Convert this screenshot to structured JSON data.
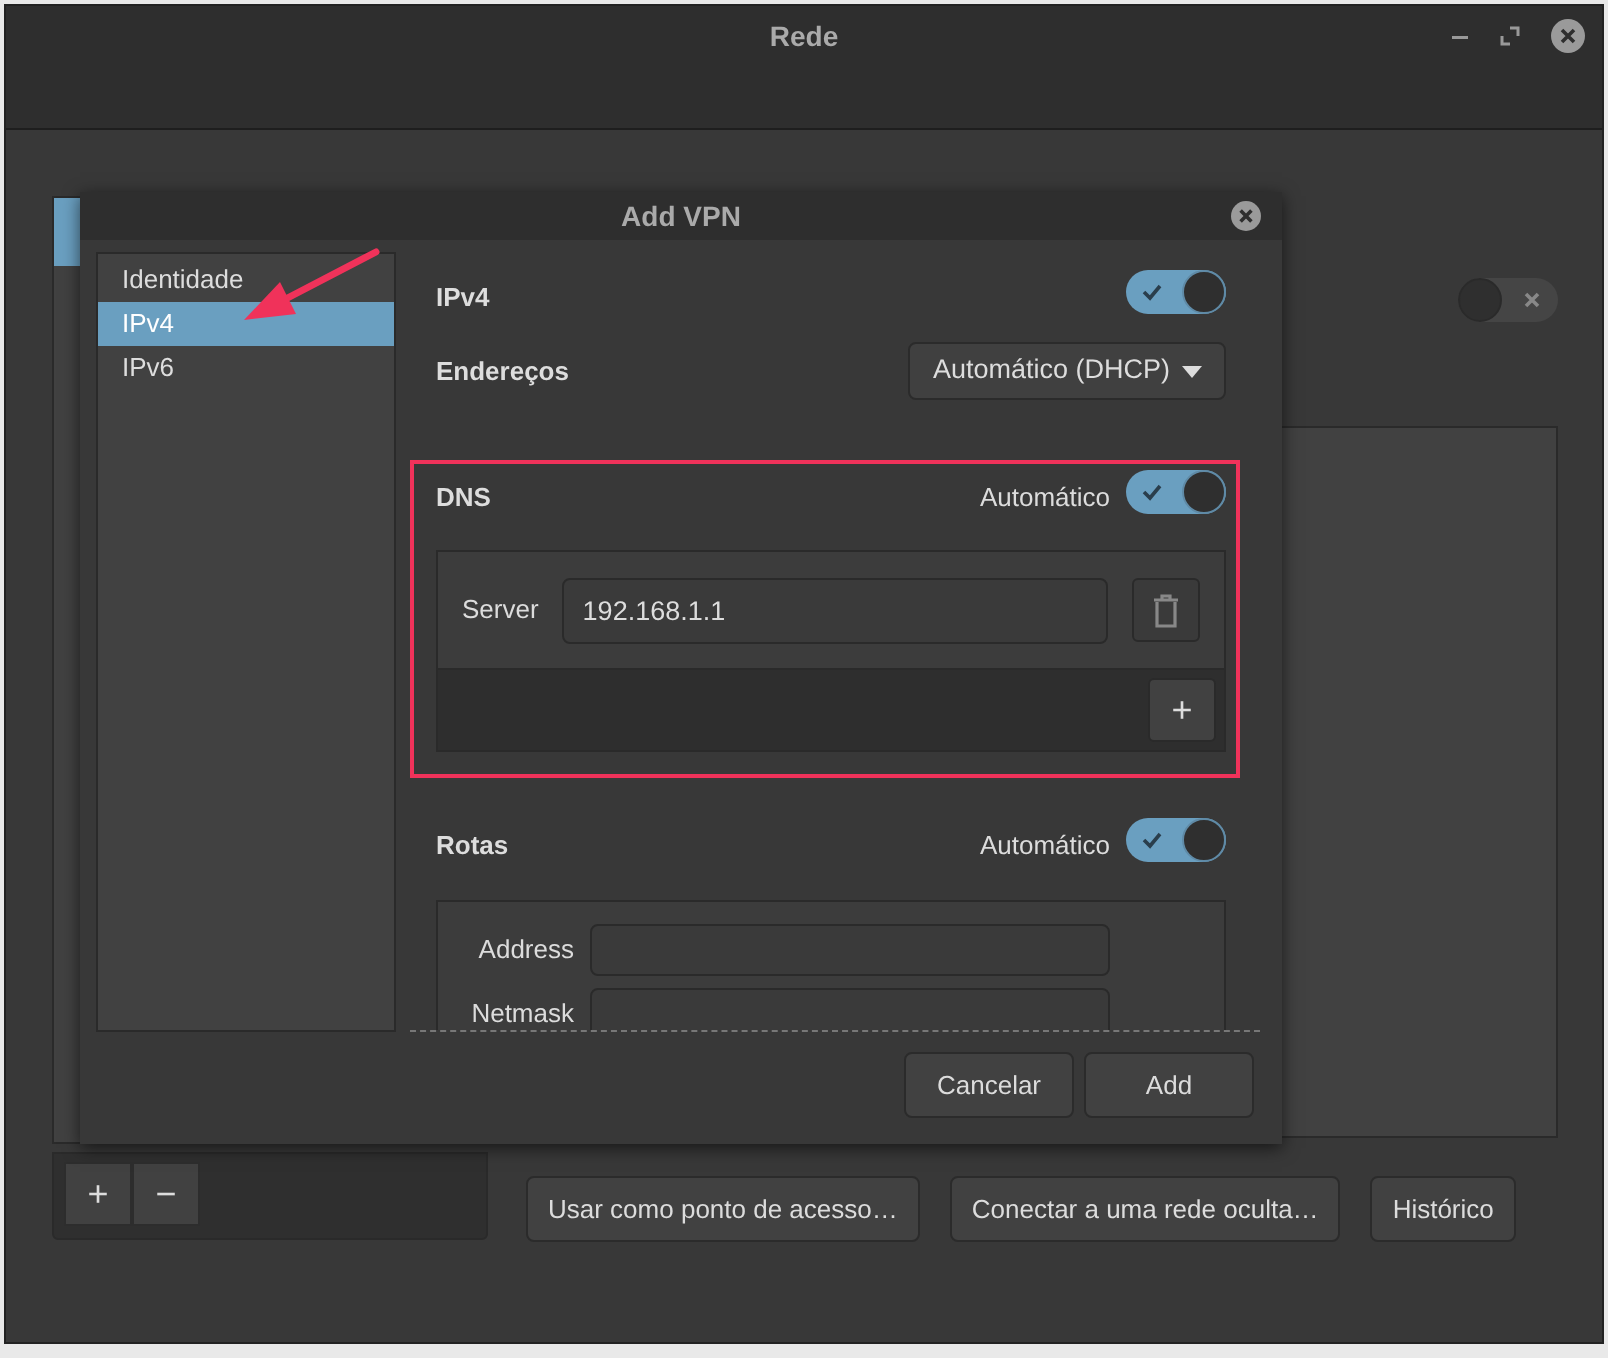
{
  "window": {
    "title": "Rede"
  },
  "main": {
    "connection_toggle": {
      "on": false
    },
    "list_tools": [
      "+",
      "−"
    ],
    "buttons": [
      "Usar como ponto de acesso…",
      "Conectar a uma rede oculta…",
      "Histórico"
    ]
  },
  "dialog": {
    "title": "Add VPN",
    "sidebar": [
      {
        "label": "Identidade",
        "selected": false
      },
      {
        "label": "IPv4",
        "selected": true
      },
      {
        "label": "IPv6",
        "selected": false
      }
    ],
    "ipv4": {
      "label": "IPv4",
      "on": true
    },
    "addresses": {
      "label": "Endereços",
      "value": "Automático (DHCP)"
    },
    "dns": {
      "label": "DNS",
      "auto_label": "Automático",
      "auto": true,
      "servers": [
        {
          "label": "Server",
          "value": "192.168.1.1"
        }
      ],
      "add_button": "+"
    },
    "routes": {
      "label": "Rotas",
      "auto_label": "Automático",
      "auto": true,
      "fields": [
        {
          "label": "Address"
        },
        {
          "label": "Netmask"
        }
      ]
    },
    "buttons": [
      "Cancelar",
      "Add"
    ]
  }
}
